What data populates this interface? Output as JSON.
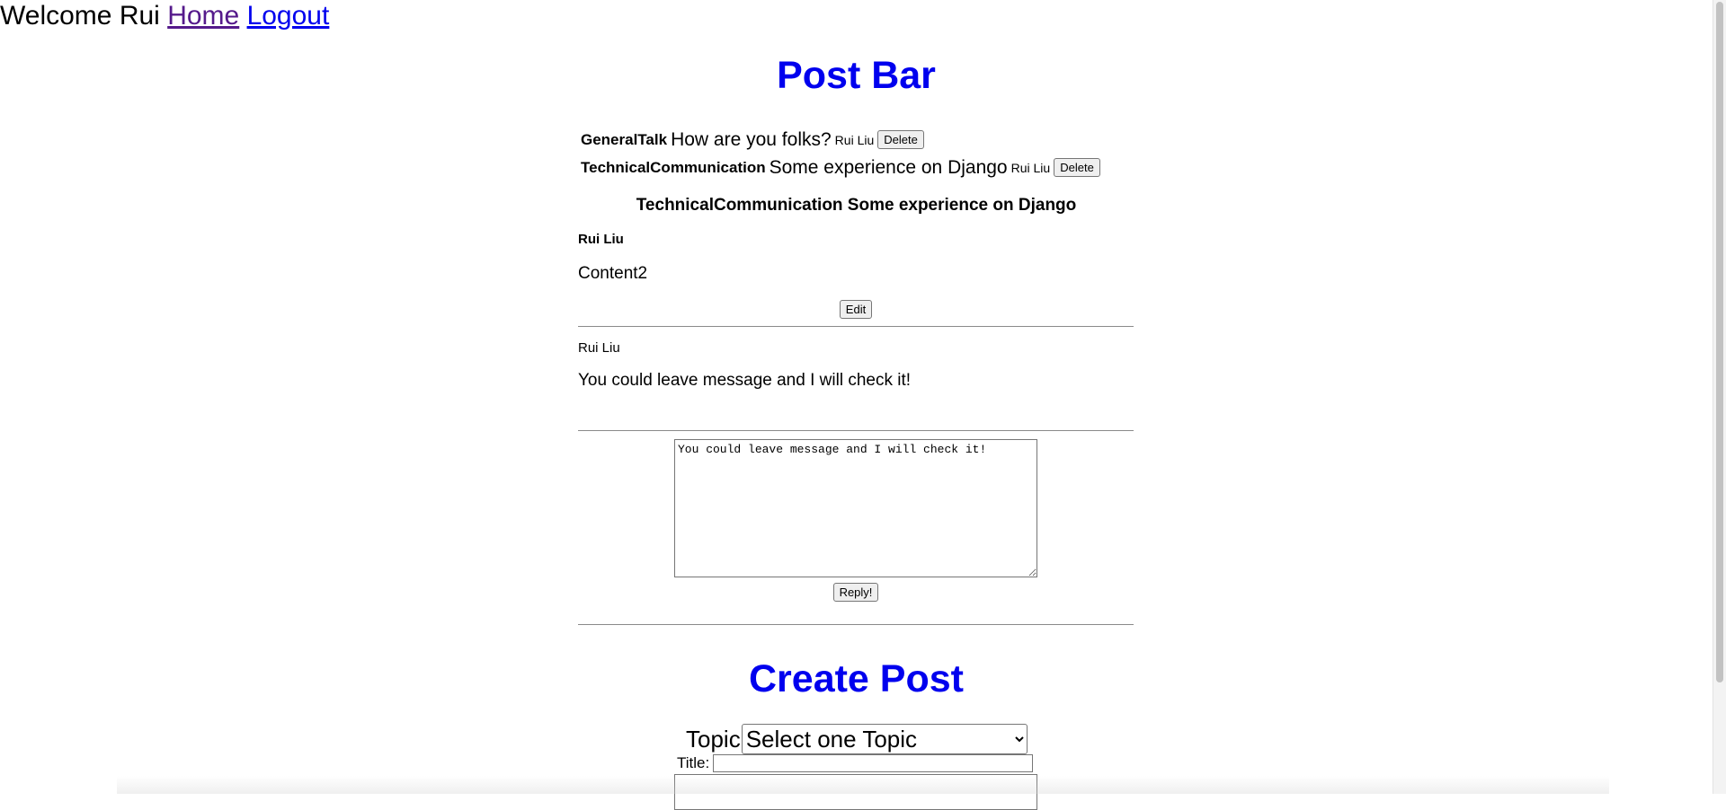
{
  "nav": {
    "welcome": "Welcome Rui",
    "home_label": "Home",
    "logout_label": "Logout"
  },
  "site_title": "Post Bar",
  "posts": [
    {
      "topic": "GeneralTalk",
      "title": "How are you folks?",
      "author": "Rui Liu",
      "delete_label": "Delete"
    },
    {
      "topic": "TechnicalCommunication",
      "title": "Some experience on Django",
      "author": "Rui Liu",
      "delete_label": "Delete"
    }
  ],
  "detail": {
    "heading": "TechnicalCommunication Some experience on Django",
    "author": "Rui Liu",
    "content": "Content2",
    "edit_label": "Edit"
  },
  "replies": [
    {
      "author": "Rui Liu",
      "content": "You could leave message and I will check it!"
    }
  ],
  "reply_form": {
    "text_value": "You could leave message and I will check it!",
    "submit_label": "Reply!"
  },
  "create": {
    "heading": "Create Post",
    "topic_label": "Topic",
    "topic_selected": "Select one Topic",
    "title_label": "Title:"
  }
}
